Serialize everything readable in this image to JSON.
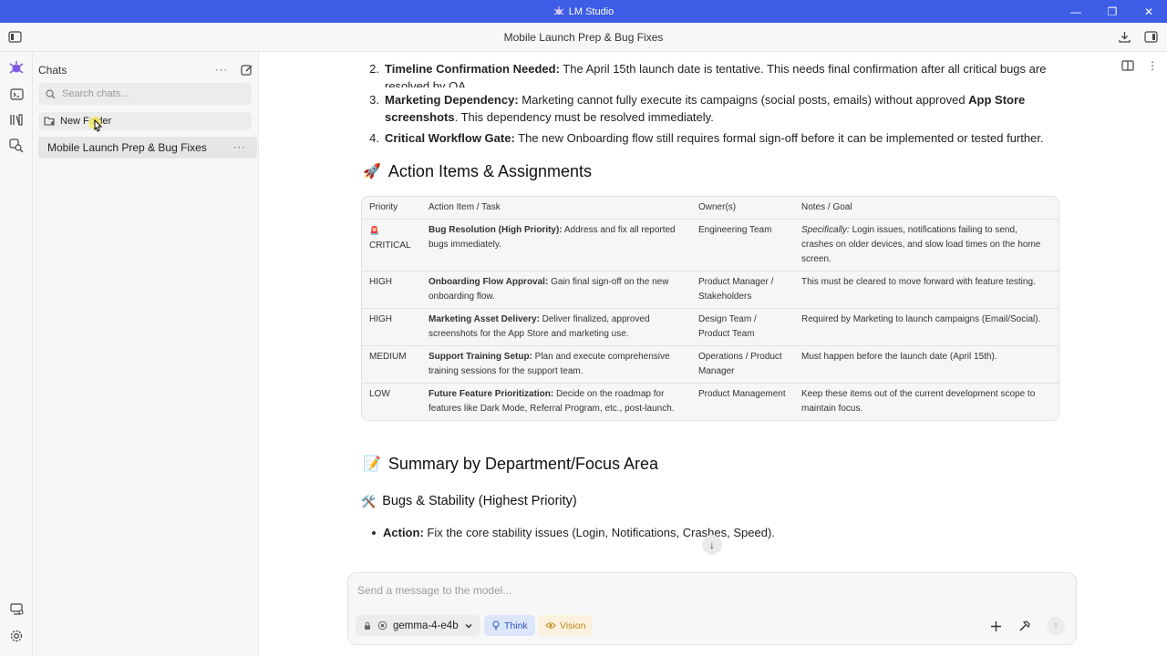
{
  "window": {
    "app_title": "LM Studio",
    "controls": {
      "minimize": "—",
      "restore": "❐",
      "close": "✕"
    }
  },
  "topbar": {
    "title": "Mobile Launch Prep & Bug Fixes"
  },
  "sidebar": {
    "header": "Chats",
    "more": "···",
    "search_placeholder": "Search chats...",
    "new_folder": "New Folder",
    "chats": [
      {
        "title": "Mobile Launch Prep & Bug Fixes",
        "more": "···"
      }
    ]
  },
  "content": {
    "list_items": [
      {
        "num": "2.",
        "bold": "Timeline Confirmation Needed:",
        "text": " The April 15th launch date is tentative. This needs final confirmation after all critical bugs are resolved by QA."
      },
      {
        "num": "3.",
        "bold": "Marketing Dependency:",
        "text": " Marketing cannot fully execute its campaigns (social posts, emails) without approved ",
        "bold2": "App Store screenshots",
        "text2": ". This dependency must be resolved immediately."
      },
      {
        "num": "4.",
        "bold": "Critical Workflow Gate:",
        "text": " The new Onboarding flow still requires formal sign-off before it can be implemented or tested further."
      }
    ],
    "action_heading": {
      "emoji": "🚀",
      "text": "Action Items & Assignments"
    },
    "table": {
      "headers": [
        "Priority",
        "Action Item / Task",
        "Owner(s)",
        "Notes / Goal"
      ],
      "rows": [
        {
          "priority_icon": "🚨",
          "priority": "CRITICAL",
          "task_bold": "Bug Resolution (High Priority):",
          "task": " Address and fix all reported bugs immediately.",
          "owner": "Engineering Team",
          "notes_em": "Specifically:",
          "notes": " Login issues, notifications failing to send, crashes on older devices, and slow load times on the home screen."
        },
        {
          "priority_icon": "",
          "priority": "HIGH",
          "task_bold": "Onboarding Flow Approval:",
          "task": " Gain final sign-off on the new onboarding flow.",
          "owner": "Product Manager / Stakeholders",
          "notes_em": "",
          "notes": "This must be cleared to move forward with feature testing."
        },
        {
          "priority_icon": "",
          "priority": "HIGH",
          "task_bold": "Marketing Asset Delivery:",
          "task": " Deliver finalized, approved screenshots for the App Store and marketing use.",
          "owner": "Design Team / Product Team",
          "notes_em": "",
          "notes": "Required by Marketing to launch campaigns (Email/Social)."
        },
        {
          "priority_icon": "",
          "priority": "MEDIUM",
          "task_bold": "Support Training Setup:",
          "task": " Plan and execute comprehensive training sessions for the support team.",
          "owner": "Operations / Product Manager",
          "notes_em": "",
          "notes": "Must happen before the launch date (April 15th)."
        },
        {
          "priority_icon": "",
          "priority": "LOW",
          "task_bold": "Future Feature Prioritization:",
          "task": " Decide on the roadmap for features like Dark Mode, Referral Program, etc., post-launch.",
          "owner": "Product Management",
          "notes_em": "",
          "notes": "Keep these items out of the current development scope to maintain focus."
        }
      ]
    },
    "summary_heading": {
      "emoji": "📝",
      "text": "Summary by Department/Focus Area"
    },
    "bugs_heading": {
      "emoji": "🛠️",
      "text": "Bugs & Stability (Highest Priority)"
    },
    "bullets": [
      {
        "bold": "Action:",
        "text": " Fix the core stability issues (Login, Notifications, Crashes, Speed)."
      }
    ]
  },
  "composer": {
    "placeholder": "Send a message to the model...",
    "model": "gemma-4-e4b",
    "think": "Think",
    "vision": "Vision"
  },
  "colors": {
    "titlebar": "#3d5de5",
    "think_bg": "#dce6fb",
    "vision_bg": "#fbf1de"
  }
}
